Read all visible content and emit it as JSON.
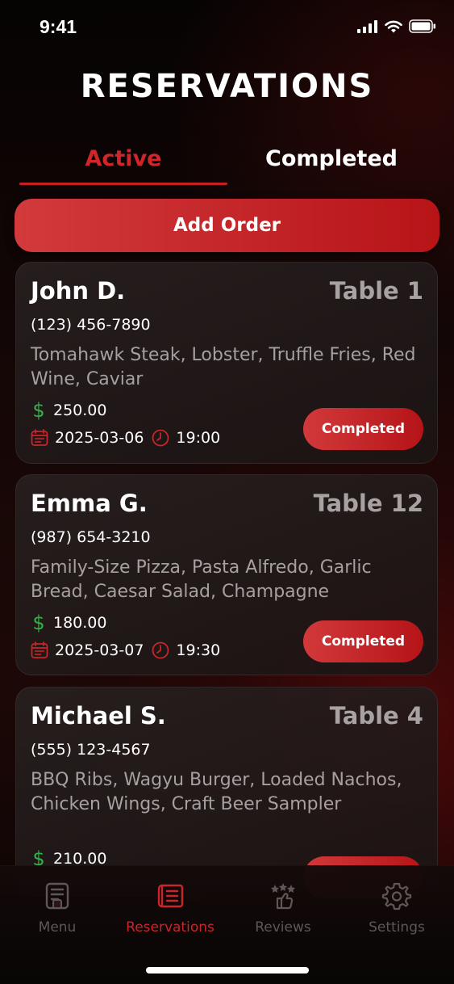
{
  "status_bar": {
    "time": "9:41"
  },
  "header": {
    "title": "RESERVATIONS"
  },
  "tabs": [
    {
      "label": "Active",
      "selected": true
    },
    {
      "label": "Completed",
      "selected": false
    }
  ],
  "add_order_label": "Add Order",
  "reservations": [
    {
      "name": "John D.",
      "table": "Table 1",
      "phone": "(123) 456-7890",
      "items": "Tomahawk Steak, Lobster, Truffle Fries, Red Wine, Caviar",
      "currency_symbol": "$",
      "price": "250.00",
      "date": "2025-03-06",
      "time": "19:00",
      "status_label": "Completed"
    },
    {
      "name": "Emma G.",
      "table": "Table 12",
      "phone": "(987) 654-3210",
      "items": "Family-Size Pizza, Pasta Alfredo, Garlic Bread, Caesar Salad, Champagne",
      "currency_symbol": "$",
      "price": "180.00",
      "date": "2025-03-07",
      "time": "19:30",
      "status_label": "Completed"
    },
    {
      "name": "Michael S.",
      "table": "Table 4",
      "phone": "(555) 123-4567",
      "items": "BBQ Ribs, Wagyu Burger, Loaded Nachos, Chicken Wings, Craft Beer Sampler",
      "currency_symbol": "$",
      "price": "210.00"
    }
  ],
  "bottom_nav": [
    {
      "label": "Menu",
      "icon": "menu-icon",
      "active": false
    },
    {
      "label": "Reservations",
      "icon": "reservations-icon",
      "active": true
    },
    {
      "label": "Reviews",
      "icon": "reviews-icon",
      "active": false
    },
    {
      "label": "Settings",
      "icon": "gear-icon",
      "active": false
    }
  ],
  "colors": {
    "accent": "#c8262a",
    "price_icon": "#2fb24a",
    "muted_text": "#a6a0a0",
    "nav_inactive": "#5f5757"
  }
}
